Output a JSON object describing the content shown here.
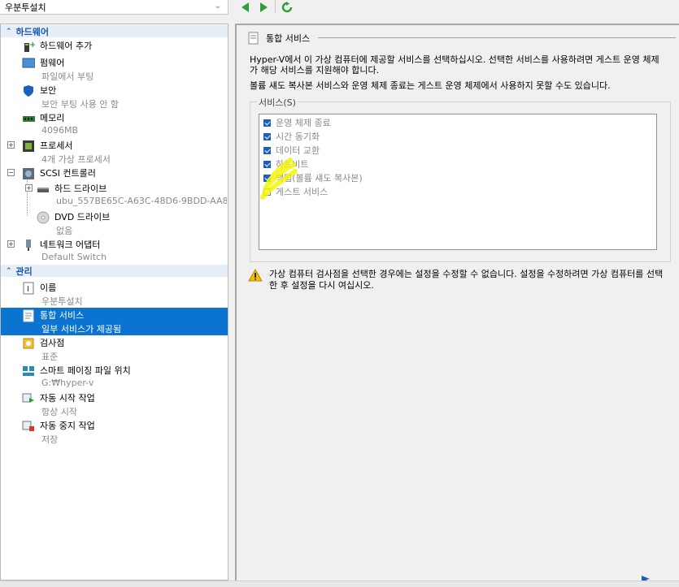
{
  "toolbar": {
    "vm_name": "우분투설치",
    "back_icon": "arrow-left-icon",
    "forward_icon": "arrow-right-icon",
    "refresh_icon": "refresh-icon"
  },
  "sidebar": {
    "hardware_header": "하드웨어",
    "management_header": "관리",
    "hardware_items": [
      {
        "label": "하드웨어 추가",
        "sub": "",
        "icon": "add-hardware-icon"
      },
      {
        "label": "펌웨어",
        "sub": "파일에서 부팅",
        "icon": "firmware-icon"
      },
      {
        "label": "보안",
        "sub": "보안 부팅 사용 안 함",
        "icon": "security-shield-icon"
      },
      {
        "label": "메모리",
        "sub": "4096MB",
        "icon": "memory-icon"
      },
      {
        "label": "프로세서",
        "sub": "4개 가상 프로세서",
        "icon": "processor-icon"
      },
      {
        "label": "SCSI 컨트롤러",
        "sub": "",
        "icon": "scsi-controller-icon"
      },
      {
        "label": "하드 드라이브",
        "sub": "ubu_557BE65C-A63C-48D6-9BDD-AA8...",
        "icon": "hard-drive-icon"
      },
      {
        "label": "DVD 드라이브",
        "sub": "없음",
        "icon": "dvd-drive-icon"
      },
      {
        "label": "네트워크 어댑터",
        "sub": "Default Switch",
        "icon": "network-adapter-icon"
      }
    ],
    "management_items": [
      {
        "label": "이름",
        "sub": "우분투설치",
        "icon": "name-icon"
      },
      {
        "label": "통합 서비스",
        "sub": "일부 서비스가 제공됨",
        "icon": "integration-services-icon"
      },
      {
        "label": "검사점",
        "sub": "표준",
        "icon": "checkpoint-icon"
      },
      {
        "label": "스마트 페이징 파일 위치",
        "sub": "G:₩hyper-v",
        "icon": "smart-paging-icon"
      },
      {
        "label": "자동 시작 작업",
        "sub": "항상 시작",
        "icon": "auto-start-icon"
      },
      {
        "label": "자동 중지 작업",
        "sub": "저장",
        "icon": "auto-stop-icon"
      }
    ]
  },
  "main": {
    "title": "통합 서비스",
    "description1": "Hyper-V에서 이 가상 컴퓨터에 제공할 서비스를 선택하십시오. 선택한 서비스를 사용하려면 게스트 운영 체제가 해당 서비스를 지원해야 합니다.",
    "description2": "볼륨 섀도 복사본 서비스와 운영 체제 종료는 게스트 운영 체제에서 사용하지 못할 수도 있습니다.",
    "services_label": "서비스(S)",
    "services": [
      {
        "label": "운영 체제 종료",
        "checked": true
      },
      {
        "label": "시간 동기화",
        "checked": true
      },
      {
        "label": "데이터 교환",
        "checked": true
      },
      {
        "label": "하트비트",
        "checked": true
      },
      {
        "label": "백업(볼륨 섀도 복사본)",
        "checked": true
      },
      {
        "label": "게스트 서비스",
        "checked": false
      }
    ],
    "warning": "가상 컴퓨터 검사점을 선택한 경우에는 설정을 수정할 수 없습니다. 설정을 수정하려면 가상 컴퓨터를 선택한 후 설정을 다시 여십시오.",
    "warning_icon": "warning-icon"
  },
  "colors": {
    "selection": "#0b74d0",
    "section_header": "#1a56b0",
    "nav_green": "#2e9e3a",
    "highlight": "#f5f50a"
  }
}
